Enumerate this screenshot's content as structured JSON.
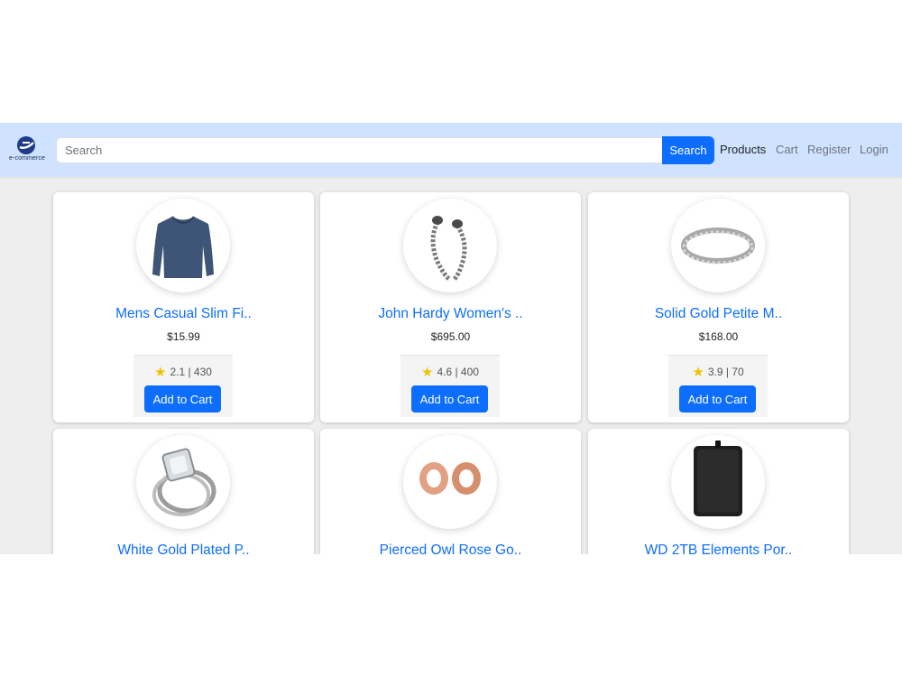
{
  "brand": {
    "logo_text": "e-commerce",
    "accent": "#0d6efd",
    "nav_bg": "#cfe2ff"
  },
  "search": {
    "placeholder": "Search",
    "button_label": "Search"
  },
  "nav": [
    {
      "label": "Products",
      "active": true
    },
    {
      "label": "Cart",
      "active": false
    },
    {
      "label": "Register",
      "active": false
    },
    {
      "label": "Login",
      "active": false
    }
  ],
  "products": [
    {
      "title": "Mens Casual Slim Fi..",
      "price": "$15.99",
      "rating": "2.1 | 430",
      "button": "Add to Cart",
      "image": "shirt-image"
    },
    {
      "title": "John Hardy Women's ..",
      "price": "$695.00",
      "rating": "4.6 | 400",
      "button": "Add to Cart",
      "image": "bracelet-image"
    },
    {
      "title": "Solid Gold Petite M..",
      "price": "$168.00",
      "rating": "3.9 | 70",
      "button": "Add to Cart",
      "image": "ring-image"
    },
    {
      "title": "White Gold Plated P..",
      "image": "engagement-ring-image"
    },
    {
      "title": "Pierced Owl Rose Go..",
      "image": "ear-plugs-image"
    },
    {
      "title": "WD 2TB Elements Por..",
      "image": "hard-drive-image"
    }
  ]
}
